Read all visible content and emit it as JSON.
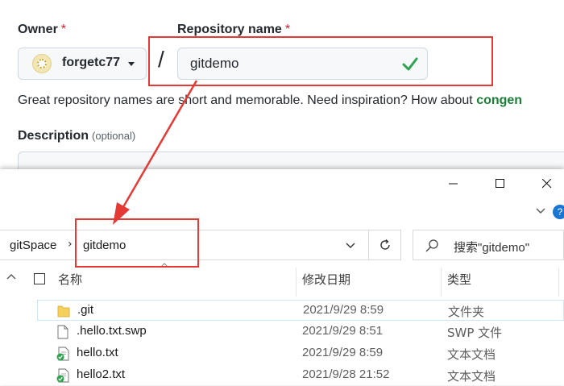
{
  "github": {
    "owner_label": "Owner",
    "required_mark": "*",
    "owner_name": "forgetc77",
    "separator": "/",
    "repo_label": "Repository name",
    "repo_value": "gitdemo",
    "hint_text": "Great repository names are short and memorable. Need inspiration? How about ",
    "hint_suggestion": "congen",
    "description_label": "Description",
    "description_optional": "(optional)"
  },
  "explorer": {
    "breadcrumb": [
      "gitSpace",
      "gitdemo"
    ],
    "breadcrumb_separator": "›",
    "search_placeholder": "搜索\"gitdemo\"",
    "columns": {
      "name": "名称",
      "modified": "修改日期",
      "type": "类型"
    },
    "files": [
      {
        "name": ".git",
        "date": "2021/9/29 8:59",
        "type": "文件夹",
        "icon": "folder-icon"
      },
      {
        "name": ".hello.txt.swp",
        "date": "2021/9/29 8:51",
        "type": "SWP 文件",
        "icon": "file-icon"
      },
      {
        "name": "hello.txt",
        "date": "2021/9/29 8:59",
        "type": "文本文档",
        "icon": "git-clean-file-icon"
      },
      {
        "name": "hello2.txt",
        "date": "2021/9/28 21:52",
        "type": "文本文档",
        "icon": "git-clean-file-icon"
      }
    ]
  },
  "colors": {
    "annotation": "#e53935",
    "required": "#cf222e",
    "suggestion": "#1a7f37",
    "valid_check": "#2da44e",
    "folder": "#f7cf5d"
  }
}
